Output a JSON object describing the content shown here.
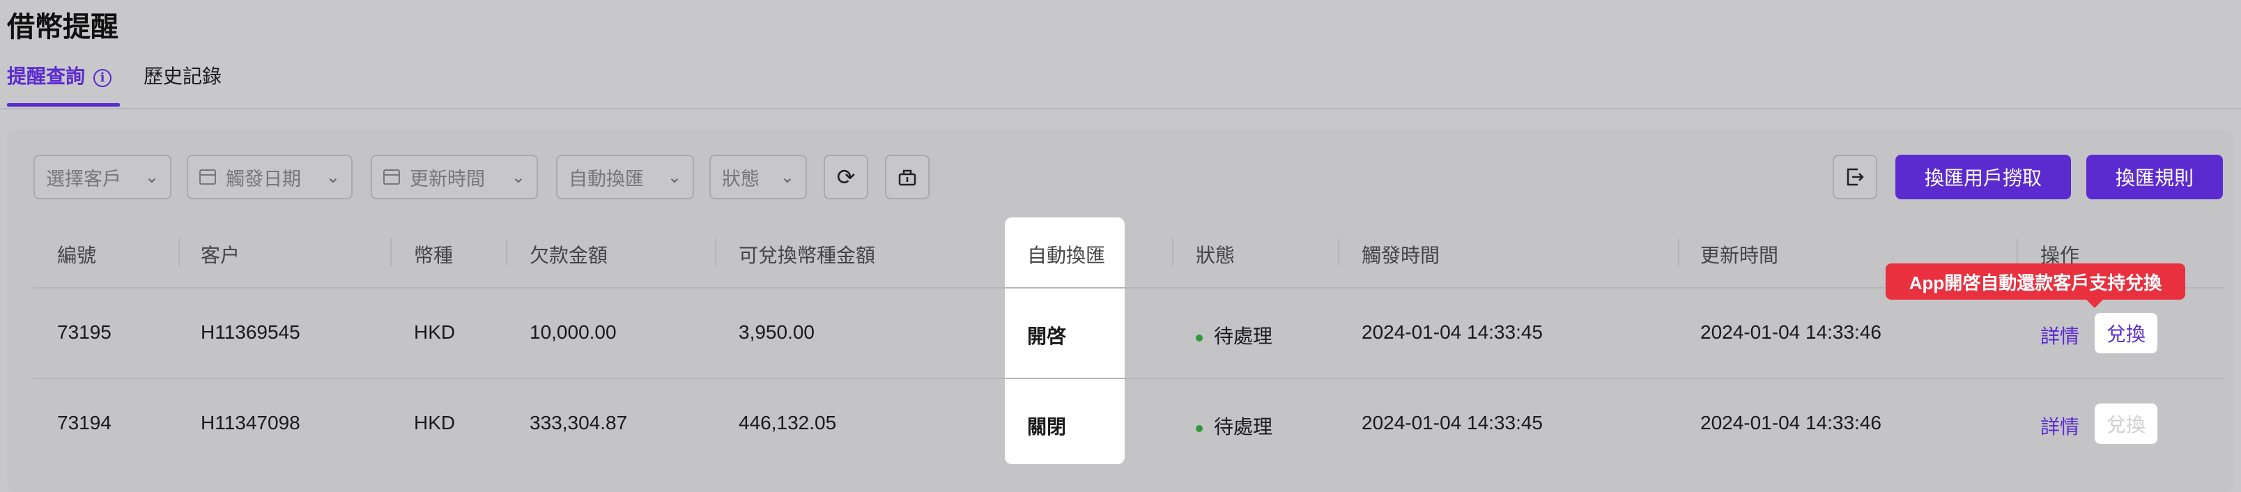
{
  "page": {
    "title": "借幣提醒"
  },
  "tabs": [
    {
      "label": "提醒查詢",
      "active": true
    },
    {
      "label": "歷史記錄",
      "active": false
    }
  ],
  "filters": {
    "customer": "選擇客戶",
    "trigger_date": "觸發日期",
    "update_time": "更新時間",
    "auto_exchange": "自動換匯",
    "status": "狀態"
  },
  "toolbar": {
    "user_fetch": "換匯用戶撈取",
    "rules": "換匯規則"
  },
  "table": {
    "columns": [
      "編號",
      "客户",
      "幣種",
      "欠款金額",
      "可兌換幣種金額",
      "自動換匯",
      "狀態",
      "觸發時間",
      "更新時間",
      "操作"
    ],
    "rows": [
      {
        "id": "73195",
        "customer": "H11369545",
        "currency": "HKD",
        "debt": "10,000.00",
        "exchangeable": "3,950.00",
        "auto": "開啓",
        "status": "待處理",
        "trigger_time": "2024-01-04 14:33:45",
        "update_time": "2024-01-04 14:33:46",
        "detail": "詳情",
        "exchange": "兌換"
      },
      {
        "id": "73194",
        "customer": "H11347098",
        "currency": "HKD",
        "debt": "333,304.87",
        "exchangeable": "446,132.05",
        "auto": "關閉",
        "status": "待處理",
        "trigger_time": "2024-01-04 14:33:45",
        "update_time": "2024-01-04 14:33:46",
        "detail": "詳情",
        "exchange": "兌換"
      }
    ]
  },
  "tooltip": "App開啓自動還款客戶支持兌換",
  "colors": {
    "accent": "#5b2bd0",
    "tooltip": "#e8303f",
    "status_dot": "#2e9a3a"
  }
}
